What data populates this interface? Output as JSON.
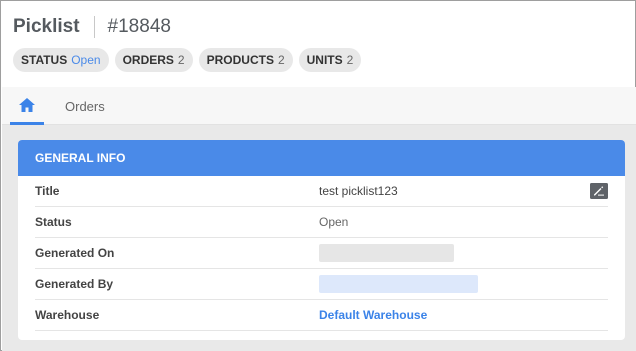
{
  "header": {
    "title": "Picklist",
    "number": "#18848"
  },
  "badges": [
    {
      "key": "STATUS",
      "value": "Open"
    },
    {
      "key": "ORDERS",
      "value": "2"
    },
    {
      "key": "PRODUCTS",
      "value": "2"
    },
    {
      "key": "UNITS",
      "value": "2"
    }
  ],
  "tabs": {
    "home_icon": "home-icon",
    "orders_label": "Orders"
  },
  "general_info": {
    "heading": "GENERAL INFO",
    "rows": [
      {
        "label": "Title",
        "value": "test picklist123",
        "icon": "edit-icon"
      },
      {
        "label": "Status",
        "value": "Open"
      },
      {
        "label": "Generated On",
        "value": ""
      },
      {
        "label": "Generated By",
        "value": ""
      },
      {
        "label": "Warehouse",
        "value": "Default Warehouse"
      }
    ]
  },
  "colors": {
    "accent": "#4a8ae8",
    "link": "#3b83e8"
  }
}
